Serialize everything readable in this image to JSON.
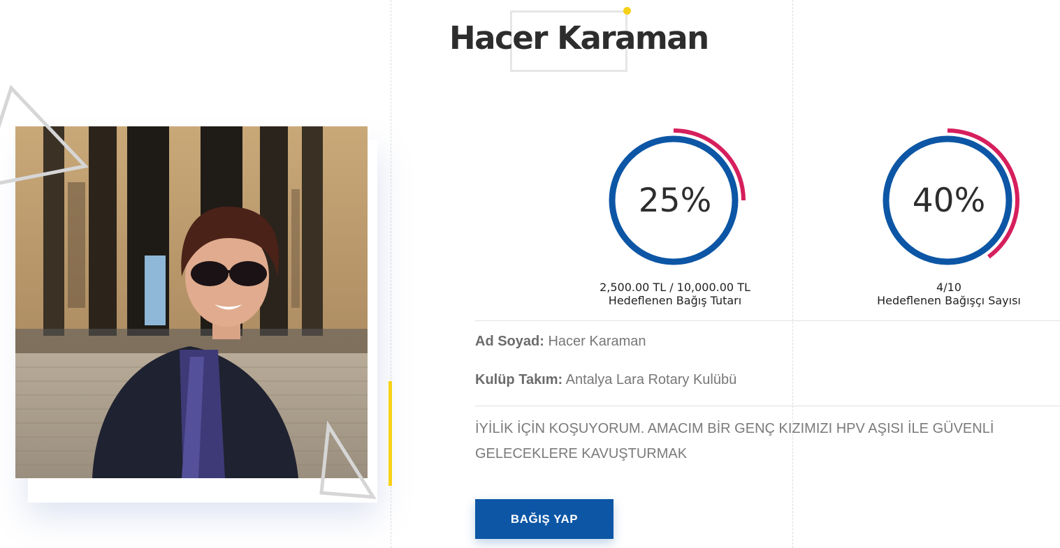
{
  "profile": {
    "name": "Hacer Karaman",
    "photo_description": "woman-in-sunglasses-at-monument"
  },
  "gauges": [
    {
      "percent_label": "25%",
      "percent_value": 25,
      "ratio": "2,500.00 TL / 10,000.00 TL",
      "caption": "Hedeflenen Bağış Tutarı"
    },
    {
      "percent_label": "40%",
      "percent_value": 40,
      "ratio": "4/10",
      "caption": "Hedeflenen Bağışçı Sayısı"
    }
  ],
  "details": {
    "name_label": "Ad Soyad:",
    "name_value": "Hacer Karaman",
    "club_label": "Kulüp Takım:",
    "club_value": "Antalya Lara Rotary Kulübü"
  },
  "description": "İYİLİK İÇİN KOŞUYORUM. AMACIM BİR GENÇ KIZIMIZI HPV AŞISI İLE GÜVENLİ GELECEKLERE KAVUŞTURMAK",
  "cta": {
    "label": "BAĞIŞ YAP"
  },
  "colors": {
    "primary_blue": "#0c56a5",
    "accent_pink": "#d61f5d",
    "accent_yellow": "#f7d117"
  }
}
